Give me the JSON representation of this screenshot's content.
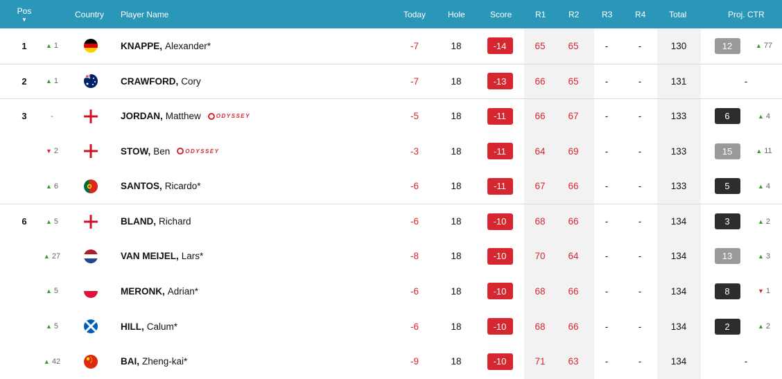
{
  "header": {
    "pos": "Pos",
    "country": "Country",
    "player": "Player Name",
    "today": "Today",
    "hole": "Hole",
    "score": "Score",
    "r1": "R1",
    "r2": "R2",
    "r3": "R3",
    "r4": "R4",
    "total": "Total",
    "ctr": "Proj. CTR"
  },
  "sponsor": "ODYSSEY",
  "colors": {
    "header": "#2b97b8",
    "red": "#d6262f",
    "green": "#2ca12c",
    "dark_badge": "#2d2d2d",
    "grey_badge": "#9a9a9a",
    "band": "#f2f2f2"
  },
  "rows": [
    {
      "pos": "1",
      "move_dir": "up",
      "move": "1",
      "flag": "germany-flag-icon",
      "last": "KNAPPE,",
      "first": "Alexander*",
      "sponsor": false,
      "today": "-7",
      "hole": "18",
      "score": "-14",
      "r1": "65",
      "r2": "65",
      "r3": "-",
      "r4": "-",
      "total": "130",
      "ctr": "12",
      "ctr_style": "grey",
      "ctr_dir": "up",
      "ctr_move": "77",
      "sep": false
    },
    {
      "pos": "2",
      "move_dir": "up",
      "move": "1",
      "flag": "australia-flag-icon",
      "last": "CRAWFORD,",
      "first": "Cory",
      "sponsor": false,
      "today": "-7",
      "hole": "18",
      "score": "-13",
      "r1": "66",
      "r2": "65",
      "r3": "-",
      "r4": "-",
      "total": "131",
      "ctr": "-",
      "ctr_style": "none",
      "ctr_dir": "",
      "ctr_move": "",
      "sep": true
    },
    {
      "pos": "3",
      "move_dir": "none",
      "move": "-",
      "flag": "england-flag-icon",
      "last": "JORDAN,",
      "first": "Matthew",
      "sponsor": true,
      "today": "-5",
      "hole": "18",
      "score": "-11",
      "r1": "66",
      "r2": "67",
      "r3": "-",
      "r4": "-",
      "total": "133",
      "ctr": "6",
      "ctr_style": "dark",
      "ctr_dir": "up",
      "ctr_move": "4",
      "sep": true
    },
    {
      "pos": "",
      "move_dir": "down",
      "move": "2",
      "flag": "england-flag-icon",
      "last": "STOW,",
      "first": "Ben",
      "sponsor": true,
      "today": "-3",
      "hole": "18",
      "score": "-11",
      "r1": "64",
      "r2": "69",
      "r3": "-",
      "r4": "-",
      "total": "133",
      "ctr": "15",
      "ctr_style": "grey",
      "ctr_dir": "up",
      "ctr_move": "11",
      "sep": false
    },
    {
      "pos": "",
      "move_dir": "up",
      "move": "6",
      "flag": "portugal-flag-icon",
      "last": "SANTOS,",
      "first": "Ricardo*",
      "sponsor": false,
      "today": "-6",
      "hole": "18",
      "score": "-11",
      "r1": "67",
      "r2": "66",
      "r3": "-",
      "r4": "-",
      "total": "133",
      "ctr": "5",
      "ctr_style": "dark",
      "ctr_dir": "up",
      "ctr_move": "4",
      "sep": false
    },
    {
      "pos": "6",
      "move_dir": "up",
      "move": "5",
      "flag": "england-flag-icon",
      "last": "BLAND,",
      "first": "Richard",
      "sponsor": false,
      "today": "-6",
      "hole": "18",
      "score": "-10",
      "r1": "68",
      "r2": "66",
      "r3": "-",
      "r4": "-",
      "total": "134",
      "ctr": "3",
      "ctr_style": "dark",
      "ctr_dir": "up",
      "ctr_move": "2",
      "sep": true
    },
    {
      "pos": "",
      "move_dir": "up",
      "move": "27",
      "flag": "netherlands-flag-icon",
      "last": "VAN MEIJEL,",
      "first": "Lars*",
      "sponsor": false,
      "today": "-8",
      "hole": "18",
      "score": "-10",
      "r1": "70",
      "r2": "64",
      "r3": "-",
      "r4": "-",
      "total": "134",
      "ctr": "13",
      "ctr_style": "grey",
      "ctr_dir": "up",
      "ctr_move": "3",
      "sep": false
    },
    {
      "pos": "",
      "move_dir": "up",
      "move": "5",
      "flag": "poland-flag-icon",
      "last": "MERONK,",
      "first": "Adrian*",
      "sponsor": false,
      "today": "-6",
      "hole": "18",
      "score": "-10",
      "r1": "68",
      "r2": "66",
      "r3": "-",
      "r4": "-",
      "total": "134",
      "ctr": "8",
      "ctr_style": "dark",
      "ctr_dir": "down",
      "ctr_move": "1",
      "sep": false
    },
    {
      "pos": "",
      "move_dir": "up",
      "move": "5",
      "flag": "scotland-flag-icon",
      "last": "HILL,",
      "first": "Calum*",
      "sponsor": false,
      "today": "-6",
      "hole": "18",
      "score": "-10",
      "r1": "68",
      "r2": "66",
      "r3": "-",
      "r4": "-",
      "total": "134",
      "ctr": "2",
      "ctr_style": "dark",
      "ctr_dir": "up",
      "ctr_move": "2",
      "sep": false
    },
    {
      "pos": "",
      "move_dir": "up",
      "move": "42",
      "flag": "china-flag-icon",
      "last": "BAI,",
      "first": "Zheng-kai*",
      "sponsor": false,
      "today": "-9",
      "hole": "18",
      "score": "-10",
      "r1": "71",
      "r2": "63",
      "r3": "-",
      "r4": "-",
      "total": "134",
      "ctr": "-",
      "ctr_style": "none",
      "ctr_dir": "",
      "ctr_move": "",
      "sep": false
    }
  ]
}
